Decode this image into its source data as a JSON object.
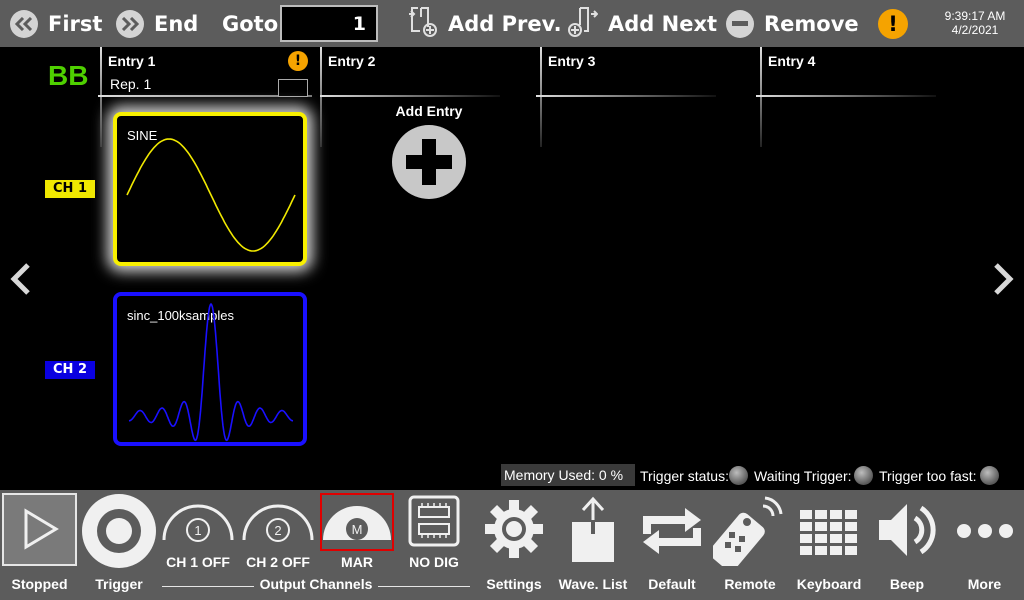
{
  "toolbar": {
    "first_label": "First",
    "end_label": "End",
    "goto_label": "Goto",
    "goto_value": "1",
    "add_prev_label": "Add Prev.",
    "add_next_label": "Add Next",
    "remove_label": "Remove",
    "warning_glyph": "!",
    "time": "9:39:17 AM",
    "date": "4/2/2021"
  },
  "sequence": {
    "badge": "BB",
    "entries": [
      {
        "label": "Entry  1"
      },
      {
        "label": "Entry  2"
      },
      {
        "label": "Entry  3"
      },
      {
        "label": "Entry  4"
      }
    ],
    "rep_label": "Rep.  1",
    "add_entry_label": "Add Entry"
  },
  "channels": {
    "ch1": {
      "label": "CH 1",
      "waveform": "SINE",
      "color": "#f8f000"
    },
    "ch2": {
      "label": "CH 2",
      "waveform": "sinc_100ksamples",
      "color": "#1a10ff"
    }
  },
  "status": {
    "memory_used": "Memory Used:   0 %",
    "trigger_status": "Trigger status:",
    "waiting_trigger": "Waiting Trigger:",
    "trigger_too_fast": "Trigger too fast:"
  },
  "bottom": {
    "stopped": "Stopped",
    "trigger": "Trigger",
    "ch1_off": "CH 1 OFF",
    "ch1_num": "1",
    "ch2_off": "CH 2 OFF",
    "ch2_num": "2",
    "mar": "MAR",
    "mar_letter": "M",
    "no_dig": "NO DIG",
    "output_channels": "Output Channels",
    "settings": "Settings",
    "wave_list": "Wave. List",
    "default": "Default",
    "remote": "Remote",
    "keyboard": "Keyboard",
    "beep": "Beep",
    "more": "More"
  },
  "icons": {
    "first": "double-chevron-left-icon",
    "end": "double-chevron-right-icon",
    "add_prev": "add-before-icon",
    "add_next": "add-after-icon",
    "remove": "minus-circle-icon",
    "warning": "warning-icon"
  }
}
